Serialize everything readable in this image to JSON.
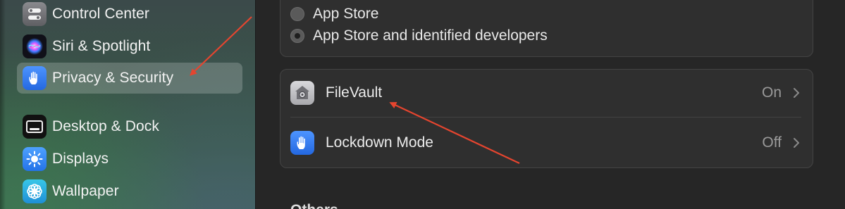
{
  "sidebar": {
    "items": [
      {
        "label": "Control Center",
        "icon": "control-center-icon"
      },
      {
        "label": "Siri & Spotlight",
        "icon": "siri-icon"
      },
      {
        "label": "Privacy & Security",
        "icon": "hand-icon",
        "selected": true
      },
      {
        "label": "Desktop & Dock",
        "icon": "desktop-dock-icon"
      },
      {
        "label": "Displays",
        "icon": "brightness-icon"
      },
      {
        "label": "Wallpaper",
        "icon": "flower-icon"
      }
    ]
  },
  "security": {
    "allow_apps_options": [
      {
        "label": "App Store",
        "selected": false
      },
      {
        "label": "App Store and identified developers",
        "selected": true
      }
    ],
    "rows": [
      {
        "label": "FileVault",
        "value": "On",
        "icon": "filevault-icon"
      },
      {
        "label": "Lockdown Mode",
        "value": "Off",
        "icon": "hand-icon"
      }
    ]
  },
  "next_section_title": "Others",
  "colors": {
    "accent_blue": "#2f7cf6",
    "annotation_red": "#e5452f",
    "sidebar_green": "#3b5d4a",
    "panel_bg": "#262626"
  }
}
